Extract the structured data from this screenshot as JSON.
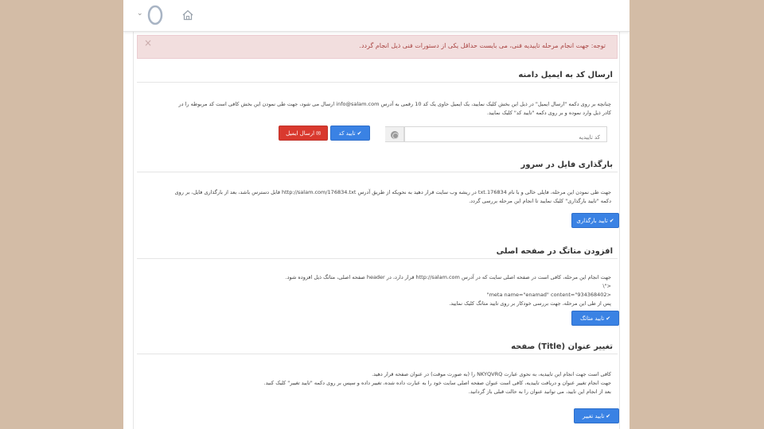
{
  "alert": {
    "text": "توجه: جهت انجام مرحله تاییدیه فنی، می بایست حداقل یکی از دستورات فنی ذیل انجام گردد.",
    "close": "×"
  },
  "email_section": {
    "title": "ارسال کد به ایمیل دامنه",
    "line1": "چنانچه بر روی دکمه \"ارسال ایمیل\" در ذیل این بخش کلیک نمایید، یک ایمیل حاوی یک کد 10 رقمی به آدرس info@salam.com ارسال می شود، جهت طی نمودن این بخش کافی است کد مربوطه را در",
    "line2": "کادر ذیل وارد نموده و بر روی دکمه \"تایید کد\" کلیک نمایید.",
    "code_placeholder": "کد تاییدیه",
    "confirm_code_label": "تایید کد",
    "send_email_label": "ارسال ایمیل"
  },
  "upload_section": {
    "title": "بارگذاری فایل در سرور",
    "line1": "جهت طی نمودن این مرحله، فایلی خالی و با نام 176834.txt در ریشه وب سایت قرار دهید به نحویکه از طریق آدرس http://salam.com/176834.txt قابل دسترس باشد، بعد از بارگذاری فایل، بر روی",
    "line2": "دکمه \"تایید بارگذاری\" کلیک نمایید تا انجام این مرحله بررسی گردد.",
    "button_label": "تایید بارگذاری"
  },
  "meta_section": {
    "title": "افزودن متاتگ در صفحه اصلی",
    "line1": "جهت انجام این مرحله، کافی است در صفحه اصلی سایت که در آدرس http://salam.com قرار دارد، در header صفحه اصلی، متاتگ ذیل افزوده شود.",
    "line2": "<\"\\",
    "line3": "<meta name=\"enamad\" content=\"934368402\"",
    "line4": "پس از طی این مرحله، جهت بررسی خودکار بر روی تایید متاتگ کلیک نمایید.",
    "button_label": "تایید متاتگ"
  },
  "title_section": {
    "title": "تغییر عنوان (Title) صفحه",
    "line1": "کافی است جهت انجام این تاییدیه، به نحوی عبارت NKYQVRQ را (به صورت موقت) در عنوان صفحه قرار دهید.",
    "line2": "جهت انجام تغییر عنوان و دریافت تاییدیه، کافی است عنوان صفحه اصلی سایت خود را به عبارت داده شده، تغییر داده و سپس بر روی دکمه \"تایید تغییر\" کلیک کنید.",
    "line3": "بعد از انجام این تایید، می توانید عنوان را به حالت قبلی باز گردانید.",
    "button_label": "تایید تغییر"
  },
  "icons": {
    "check": "✔",
    "envelope": "✉",
    "chevron": "⌄"
  },
  "colors": {
    "primary": "#3a82e4",
    "danger": "#d9392e",
    "alert_bg": "#f2dede",
    "alert_text": "#a94442"
  }
}
